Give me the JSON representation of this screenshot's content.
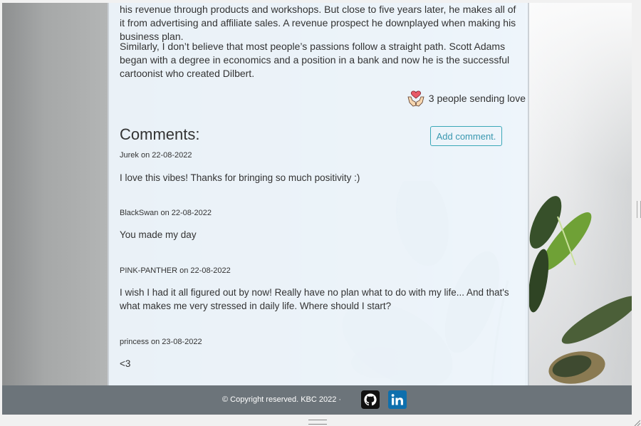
{
  "post": {
    "para1": "his revenue through products and workshops. But close to five years later, he makes all of it from advertising and affiliate sales. A revenue prospect he downplayed when making his business plan.",
    "para2": "Similarly, I don’t believe that most people’s passions follow a straight path. Scott Adams began with a degree in economics and a position in a bank and now he is the successful cartoonist who created Dilbert.",
    "love_text": "3 people sending love"
  },
  "comments": {
    "title": "Comments:",
    "add_label": "Add comment.",
    "items": [
      {
        "meta": "Jurek on 22-08-2022",
        "text": "I love this vibes! Thanks for bringing so much positivity :)"
      },
      {
        "meta": "BlackSwan on 22-08-2022",
        "text": "You made my day"
      },
      {
        "meta": "PINK-PANTHER on 22-08-2022",
        "text": "I wish I had it all figured out by now! Really have no plan what to do with my life... And that's what makes me very stressed in daily life. Where should I start?"
      },
      {
        "meta": "princess on 23-08-2022",
        "text": "<3"
      }
    ]
  },
  "footer": {
    "copyright": "© Copyright reserved. KBC 2022 ·",
    "github_icon": "github-icon",
    "linkedin_icon": "linkedin-icon"
  }
}
